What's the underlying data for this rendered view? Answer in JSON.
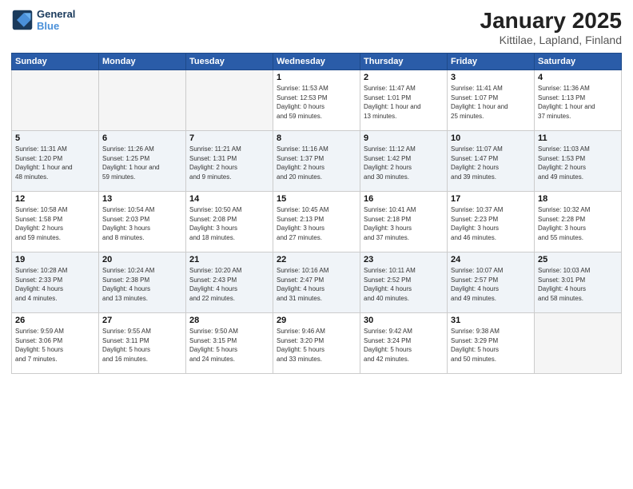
{
  "logo": {
    "line1": "General",
    "line2": "Blue"
  },
  "title": "January 2025",
  "subtitle": "Kittilae, Lapland, Finland",
  "headers": [
    "Sunday",
    "Monday",
    "Tuesday",
    "Wednesday",
    "Thursday",
    "Friday",
    "Saturday"
  ],
  "weeks": [
    [
      {
        "day": "",
        "info": ""
      },
      {
        "day": "",
        "info": ""
      },
      {
        "day": "",
        "info": ""
      },
      {
        "day": "1",
        "info": "Sunrise: 11:53 AM\nSunset: 12:53 PM\nDaylight: 0 hours\nand 59 minutes."
      },
      {
        "day": "2",
        "info": "Sunrise: 11:47 AM\nSunset: 1:01 PM\nDaylight: 1 hour and\n13 minutes."
      },
      {
        "day": "3",
        "info": "Sunrise: 11:41 AM\nSunset: 1:07 PM\nDaylight: 1 hour and\n25 minutes."
      },
      {
        "day": "4",
        "info": "Sunrise: 11:36 AM\nSunset: 1:13 PM\nDaylight: 1 hour and\n37 minutes."
      }
    ],
    [
      {
        "day": "5",
        "info": "Sunrise: 11:31 AM\nSunset: 1:20 PM\nDaylight: 1 hour and\n48 minutes."
      },
      {
        "day": "6",
        "info": "Sunrise: 11:26 AM\nSunset: 1:25 PM\nDaylight: 1 hour and\n59 minutes."
      },
      {
        "day": "7",
        "info": "Sunrise: 11:21 AM\nSunset: 1:31 PM\nDaylight: 2 hours\nand 9 minutes."
      },
      {
        "day": "8",
        "info": "Sunrise: 11:16 AM\nSunset: 1:37 PM\nDaylight: 2 hours\nand 20 minutes."
      },
      {
        "day": "9",
        "info": "Sunrise: 11:12 AM\nSunset: 1:42 PM\nDaylight: 2 hours\nand 30 minutes."
      },
      {
        "day": "10",
        "info": "Sunrise: 11:07 AM\nSunset: 1:47 PM\nDaylight: 2 hours\nand 39 minutes."
      },
      {
        "day": "11",
        "info": "Sunrise: 11:03 AM\nSunset: 1:53 PM\nDaylight: 2 hours\nand 49 minutes."
      }
    ],
    [
      {
        "day": "12",
        "info": "Sunrise: 10:58 AM\nSunset: 1:58 PM\nDaylight: 2 hours\nand 59 minutes."
      },
      {
        "day": "13",
        "info": "Sunrise: 10:54 AM\nSunset: 2:03 PM\nDaylight: 3 hours\nand 8 minutes."
      },
      {
        "day": "14",
        "info": "Sunrise: 10:50 AM\nSunset: 2:08 PM\nDaylight: 3 hours\nand 18 minutes."
      },
      {
        "day": "15",
        "info": "Sunrise: 10:45 AM\nSunset: 2:13 PM\nDaylight: 3 hours\nand 27 minutes."
      },
      {
        "day": "16",
        "info": "Sunrise: 10:41 AM\nSunset: 2:18 PM\nDaylight: 3 hours\nand 37 minutes."
      },
      {
        "day": "17",
        "info": "Sunrise: 10:37 AM\nSunset: 2:23 PM\nDaylight: 3 hours\nand 46 minutes."
      },
      {
        "day": "18",
        "info": "Sunrise: 10:32 AM\nSunset: 2:28 PM\nDaylight: 3 hours\nand 55 minutes."
      }
    ],
    [
      {
        "day": "19",
        "info": "Sunrise: 10:28 AM\nSunset: 2:33 PM\nDaylight: 4 hours\nand 4 minutes."
      },
      {
        "day": "20",
        "info": "Sunrise: 10:24 AM\nSunset: 2:38 PM\nDaylight: 4 hours\nand 13 minutes."
      },
      {
        "day": "21",
        "info": "Sunrise: 10:20 AM\nSunset: 2:43 PM\nDaylight: 4 hours\nand 22 minutes."
      },
      {
        "day": "22",
        "info": "Sunrise: 10:16 AM\nSunset: 2:47 PM\nDaylight: 4 hours\nand 31 minutes."
      },
      {
        "day": "23",
        "info": "Sunrise: 10:11 AM\nSunset: 2:52 PM\nDaylight: 4 hours\nand 40 minutes."
      },
      {
        "day": "24",
        "info": "Sunrise: 10:07 AM\nSunset: 2:57 PM\nDaylight: 4 hours\nand 49 minutes."
      },
      {
        "day": "25",
        "info": "Sunrise: 10:03 AM\nSunset: 3:01 PM\nDaylight: 4 hours\nand 58 minutes."
      }
    ],
    [
      {
        "day": "26",
        "info": "Sunrise: 9:59 AM\nSunset: 3:06 PM\nDaylight: 5 hours\nand 7 minutes."
      },
      {
        "day": "27",
        "info": "Sunrise: 9:55 AM\nSunset: 3:11 PM\nDaylight: 5 hours\nand 16 minutes."
      },
      {
        "day": "28",
        "info": "Sunrise: 9:50 AM\nSunset: 3:15 PM\nDaylight: 5 hours\nand 24 minutes."
      },
      {
        "day": "29",
        "info": "Sunrise: 9:46 AM\nSunset: 3:20 PM\nDaylight: 5 hours\nand 33 minutes."
      },
      {
        "day": "30",
        "info": "Sunrise: 9:42 AM\nSunset: 3:24 PM\nDaylight: 5 hours\nand 42 minutes."
      },
      {
        "day": "31",
        "info": "Sunrise: 9:38 AM\nSunset: 3:29 PM\nDaylight: 5 hours\nand 50 minutes."
      },
      {
        "day": "",
        "info": ""
      }
    ]
  ]
}
